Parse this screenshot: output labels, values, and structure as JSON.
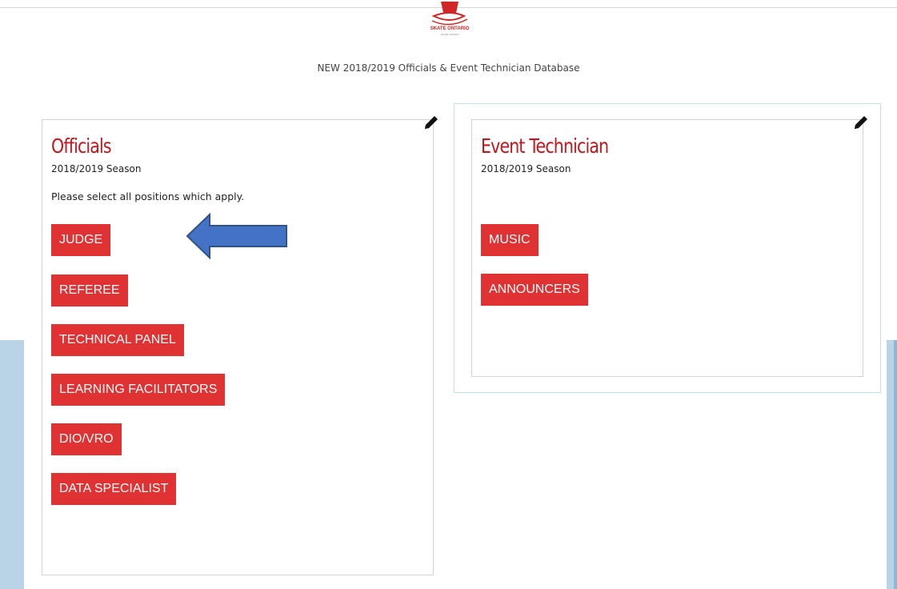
{
  "header": {
    "logo_text": "SKATE ONTARIO",
    "logo_subtext": "SKATE CANADA",
    "subtitle": "NEW 2018/2019 Officials & Event Technician Database"
  },
  "officials": {
    "title": "Officials",
    "season": "2018/2019 Season",
    "instruction": "Please select all positions which apply.",
    "buttons": [
      "JUDGE",
      "REFEREE",
      "TECHNICAL PANEL",
      "LEARNING FACILITATORS",
      "DIO/VRO",
      "DATA SPECIALIST"
    ]
  },
  "event_technician": {
    "title": "Event Technician",
    "season": "2018/2019 Season",
    "buttons": [
      "MUSIC",
      "ANNOUNCERS"
    ]
  },
  "colors": {
    "button_bg": "#e03232",
    "title_red": "#c4161c",
    "arrow_blue": "#4472c4",
    "ice_blue": "#b9d4e6"
  },
  "icons": {
    "edit": "pencil-icon",
    "arrow": "left-arrow-annotation",
    "logo": "skate-ontario-logo"
  }
}
